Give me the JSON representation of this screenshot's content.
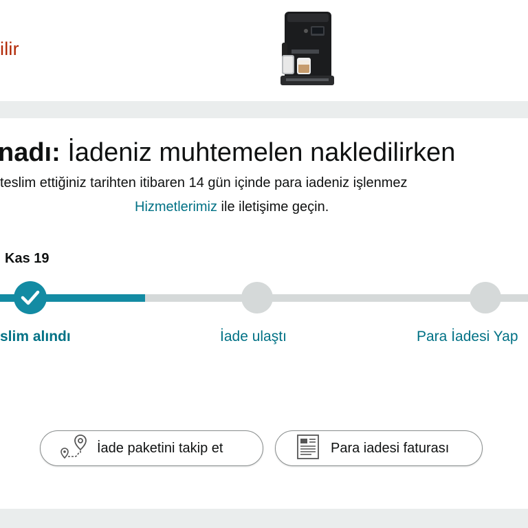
{
  "header": {
    "status_fragment": "ilir"
  },
  "notice": {
    "headline_bold": "nadı:",
    "headline_rest": " İadeniz muhtemelen nakledilirken",
    "subline": "teslim ettiğiniz tarihten itibaren 14 gün içinde para iadeniz işlenmez",
    "subline2_link": "Hizmetlerimiz",
    "subline2_rest": " ile iletişime geçin."
  },
  "progress": {
    "date": "Kas 19",
    "steps": [
      {
        "label": "slim alındı",
        "state": "done"
      },
      {
        "label": "İade ulaştı",
        "state": "pending"
      },
      {
        "label": "Para İadesi Yap",
        "state": "pending"
      }
    ],
    "colors": {
      "done": "#138ba3",
      "pending": "#d5d9d9"
    }
  },
  "actions": {
    "track_package": {
      "label": "İade paketini takip et",
      "icon": "map-route-icon"
    },
    "refund_invoice": {
      "label": "Para iadesi faturası",
      "icon": "document-icon"
    }
  },
  "colors": {
    "accent": "#007185",
    "status": "#b12704",
    "background": "#eaeded"
  }
}
